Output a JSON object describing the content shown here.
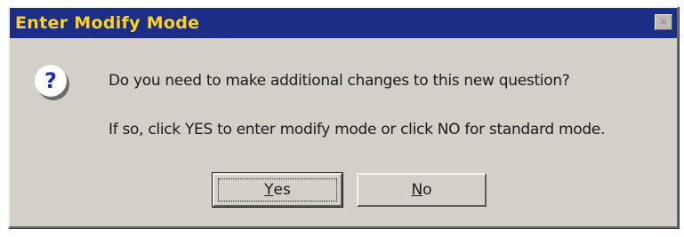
{
  "dialog": {
    "title": "Enter Modify Mode",
    "close_symbol": "×",
    "icon": {
      "name": "question-icon",
      "glyph": "?"
    },
    "message_line1": "Do you need to make additional changes to this new question?",
    "message_line2": "If so, click YES to enter modify mode or click NO for standard mode.",
    "buttons": {
      "yes": {
        "accel": "Y",
        "rest": "es"
      },
      "no": {
        "accel": "N",
        "rest": "o"
      }
    }
  },
  "colors": {
    "title_bar": "#1d2d86",
    "title_text": "#ffd21f",
    "dialog_face": "#d4d0c8"
  }
}
